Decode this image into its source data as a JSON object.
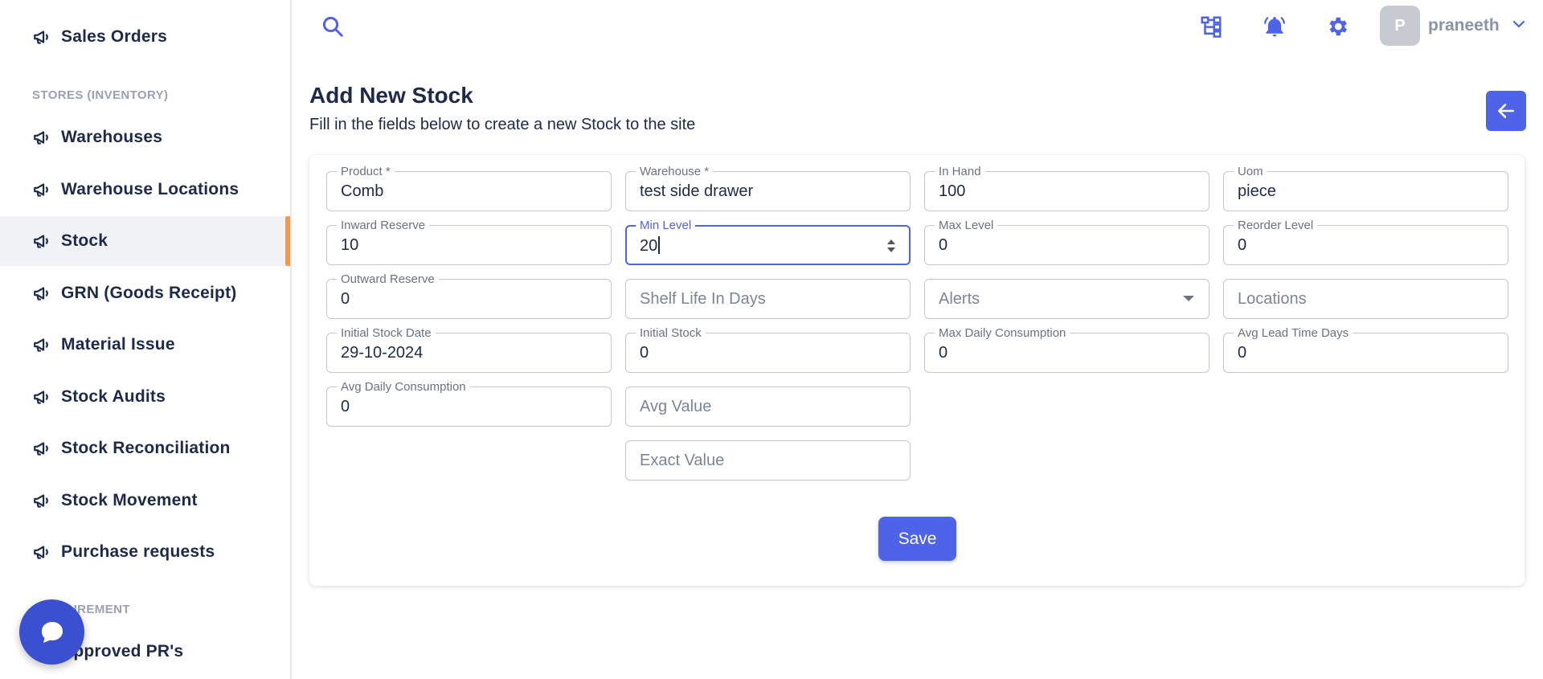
{
  "sidebar": {
    "items": [
      {
        "label": "Sales Orders"
      },
      {
        "label": "Warehouses"
      },
      {
        "label": "Warehouse Locations"
      },
      {
        "label": "Stock"
      },
      {
        "label": "GRN (Goods Receipt)"
      },
      {
        "label": "Material Issue"
      },
      {
        "label": "Stock Audits"
      },
      {
        "label": "Stock Reconciliation"
      },
      {
        "label": "Stock Movement"
      },
      {
        "label": "Purchase requests"
      },
      {
        "label": "Approved PR's"
      }
    ],
    "section_stores": "STORES (INVENTORY)",
    "section_procurement": "PROCUREMENT",
    "active": "Stock"
  },
  "topbar": {
    "avatar_initial": "P",
    "username": "praneeth"
  },
  "header": {
    "title": "Add New Stock",
    "subtitle": "Fill in the fields below to create a new Stock to the site"
  },
  "form": {
    "product": {
      "label": "Product *",
      "value": "Comb"
    },
    "warehouse": {
      "label": "Warehouse *",
      "value": "test side drawer"
    },
    "in_hand": {
      "label": "In Hand",
      "value": "100"
    },
    "uom": {
      "label": "Uom",
      "value": "piece"
    },
    "inward_reserve": {
      "label": "Inward Reserve",
      "value": "10"
    },
    "min_level": {
      "label": "Min Level",
      "value": "20"
    },
    "max_level": {
      "label": "Max Level",
      "value": "0"
    },
    "reorder_level": {
      "label": "Reorder Level",
      "value": "0"
    },
    "outward_reserve": {
      "label": "Outward Reserve",
      "value": "0"
    },
    "shelf_life": {
      "placeholder": "Shelf Life In Days"
    },
    "alerts": {
      "placeholder": "Alerts"
    },
    "locations": {
      "placeholder": "Locations"
    },
    "initial_stock_date": {
      "label": "Initial Stock Date",
      "value": "29-10-2024"
    },
    "initial_stock": {
      "label": "Initial Stock",
      "value": "0"
    },
    "max_daily_consumption": {
      "label": "Max Daily Consumption",
      "value": "0"
    },
    "avg_lead_time_days": {
      "label": "Avg Lead Time Days",
      "value": "0"
    },
    "avg_daily_consumption": {
      "label": "Avg Daily Consumption",
      "value": "0"
    },
    "avg_value": {
      "placeholder": "Avg Value"
    },
    "exact_value": {
      "placeholder": "Exact Value"
    },
    "save_label": "Save"
  },
  "colors": {
    "accent": "#4f63e8",
    "active_marker": "#f29a4a",
    "nav_text": "#1e2a4a"
  }
}
